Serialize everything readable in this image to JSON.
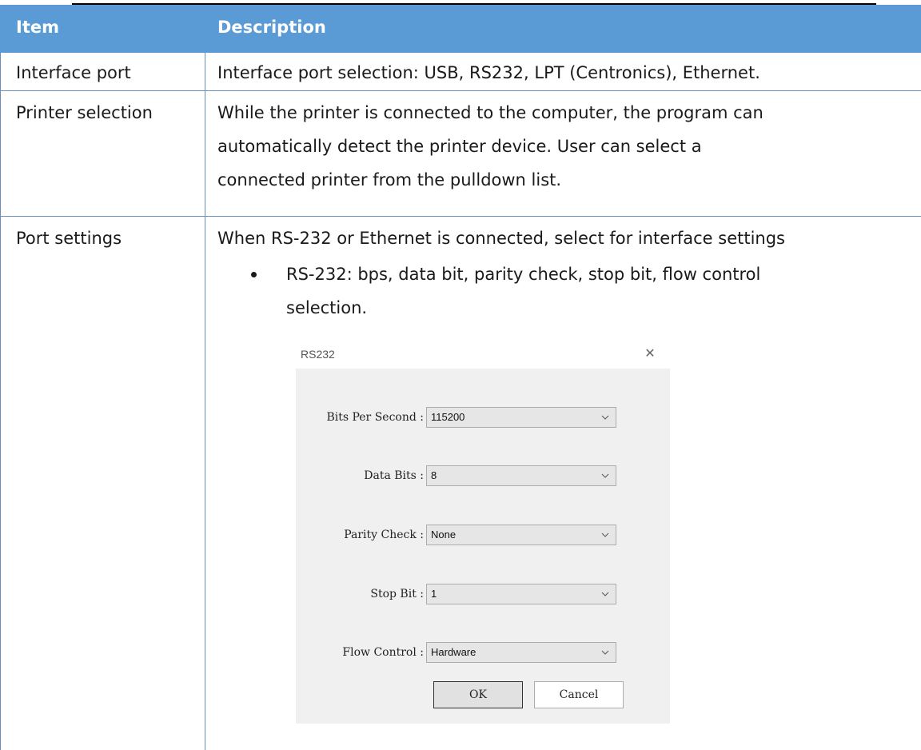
{
  "table": {
    "header": {
      "item": "Item",
      "description": "Description"
    },
    "rows": [
      {
        "item": "Interface port",
        "lines": [
          "Interface port selection: USB, RS232, LPT (Centronics), Ethernet."
        ]
      },
      {
        "item": "Printer selection",
        "lines": [
          "While the printer is connected to the computer, the program can",
          "automatically detect the printer device. User can select a",
          "connected printer from the pulldown list."
        ]
      },
      {
        "item": "Port settings",
        "lines": [
          "When RS-232 or Ethernet is connected, select for interface settings"
        ],
        "bullet_lines": [
          "RS-232: bps, data bit, parity check, stop bit, flow control",
          "selection."
        ]
      }
    ]
  },
  "dialog": {
    "title": "RS232",
    "close_icon": "close-icon",
    "fields": [
      {
        "label": "Bits Per Second :",
        "value": "115200"
      },
      {
        "label": "Data Bits :",
        "value": "8"
      },
      {
        "label": "Parity Check :",
        "value": "None"
      },
      {
        "label": "Stop Bit :",
        "value": "1"
      },
      {
        "label": "Flow Control :",
        "value": "Hardware"
      }
    ],
    "ok_label": "OK",
    "cancel_label": "Cancel"
  },
  "colors": {
    "header_bg": "#5b9bd5",
    "border": "#6c8ebf",
    "dialog_bg": "#f0f0f0"
  }
}
